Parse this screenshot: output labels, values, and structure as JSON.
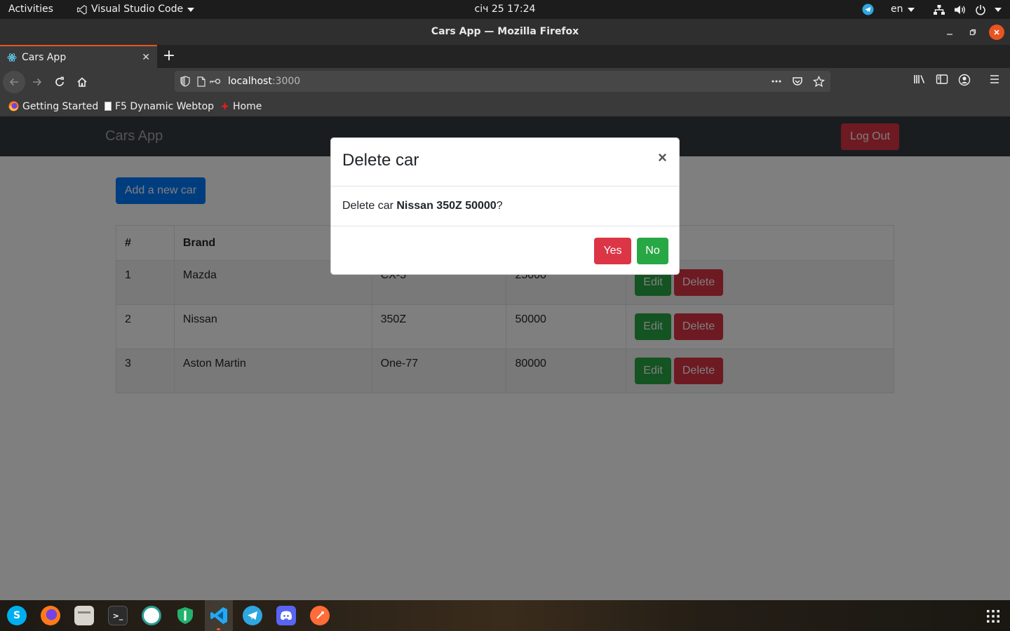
{
  "topbar": {
    "activities": "Activities",
    "app_menu": "Visual Studio Code",
    "clock": "січ 25  17:24",
    "lang": "en"
  },
  "window": {
    "title": "Cars App — Mozilla Firefox"
  },
  "browser": {
    "tab_title": "Cars App",
    "url_host": "localhost",
    "url_port": ":3000",
    "bookmarks": [
      "Getting Started",
      "F5 Dynamic Webtop",
      "Home"
    ]
  },
  "app": {
    "brand": "Cars App",
    "logout_label": "Log Out",
    "add_label": "Add a new car",
    "table": {
      "headers": [
        "#",
        "Brand",
        "",
        "",
        ""
      ],
      "rows": [
        {
          "num": "1",
          "brand": "Mazda",
          "model": "CX-5",
          "price": "25000"
        },
        {
          "num": "2",
          "brand": "Nissan",
          "model": "350Z",
          "price": "50000"
        },
        {
          "num": "3",
          "brand": "Aston Martin",
          "model": "One-77",
          "price": "80000"
        }
      ],
      "edit_label": "Edit",
      "delete_label": "Delete"
    }
  },
  "modal": {
    "title": "Delete car",
    "close": "×",
    "body_prefix": "Delete car ",
    "body_bold": "Nissan 350Z 50000",
    "body_suffix": "?",
    "yes_label": "Yes",
    "no_label": "No"
  },
  "colors": {
    "navbar": "#343a40",
    "primary": "#007bff",
    "danger": "#dc3545",
    "success": "#28a745",
    "ubuntu_orange": "#e95420"
  },
  "dock_icons": [
    "skype-icon",
    "firefox-icon",
    "files-icon",
    "terminal-icon",
    "webtop-icon",
    "vpn-shield-icon",
    "vscode-icon",
    "telegram-icon",
    "discord-icon",
    "postman-icon"
  ]
}
